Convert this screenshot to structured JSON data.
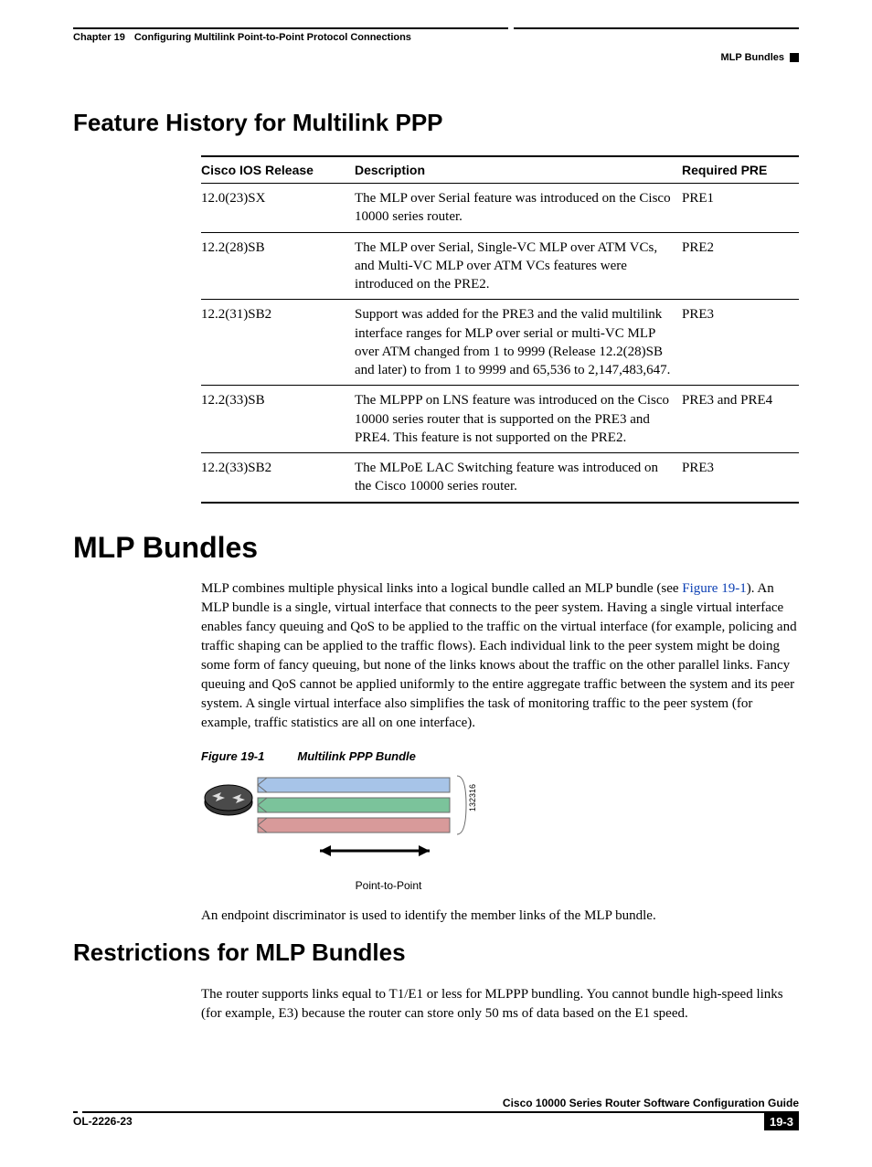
{
  "header": {
    "chapter_label": "Chapter 19",
    "chapter_title": "Configuring Multilink Point-to-Point Protocol Connections",
    "breadcrumb": "MLP Bundles"
  },
  "section1": {
    "title": "Feature History for Multilink PPP",
    "table": {
      "headers": [
        "Cisco IOS Release",
        "Description",
        "Required PRE"
      ],
      "rows": [
        {
          "release": "12.0(23)SX",
          "desc": "The MLP over Serial feature was introduced on the Cisco 10000 series router.",
          "pre": "PRE1"
        },
        {
          "release": "12.2(28)SB",
          "desc": "The MLP over Serial, Single-VC MLP over ATM VCs, and Multi-VC MLP over ATM VCs features were introduced on the PRE2.",
          "pre": "PRE2"
        },
        {
          "release": "12.2(31)SB2",
          "desc": "Support was added for the PRE3 and the valid multilink interface ranges for MLP over serial or multi-VC MLP over ATM changed from 1 to 9999 (Release 12.2(28)SB and later) to from 1 to 9999 and 65,536 to 2,147,483,647.",
          "pre": "PRE3"
        },
        {
          "release": "12.2(33)SB",
          "desc": "The MLPPP on LNS feature was introduced on the Cisco 10000 series router that is supported on the PRE3 and PRE4. This feature is not supported on the PRE2.",
          "pre": "PRE3 and PRE4"
        },
        {
          "release": "12.2(33)SB2",
          "desc": "The MLPoE LAC Switching feature was introduced on the Cisco 10000 series router.",
          "pre": "PRE3"
        }
      ]
    }
  },
  "section2": {
    "title": "MLP Bundles",
    "para_pre": "MLP combines multiple physical links into a logical bundle called an MLP bundle (see ",
    "figref": "Figure 19-1",
    "para_post": "). An MLP bundle is a single, virtual interface that connects to the peer system. Having a single virtual interface enables fancy queuing and QoS to be applied to the traffic on the virtual interface (for example, policing and traffic shaping can be applied to the traffic flows). Each individual link to the peer system might be doing some form of fancy queuing, but none of the links knows about the traffic on the other parallel links. Fancy queuing and QoS cannot be applied uniformly to the entire aggregate traffic between the system and its peer system. A single virtual interface also simplifies the task of monitoring traffic to the peer system (for example, traffic statistics are all on one interface).",
    "figure": {
      "num": "Figure 19-1",
      "title": "Multilink PPP Bundle",
      "label": "Point-to-Point",
      "id": "132316"
    },
    "para2": "An endpoint discriminator is used to identify the member links of the MLP bundle."
  },
  "section3": {
    "title": "Restrictions for MLP Bundles",
    "para": "The router supports links equal to T1/E1 or less for MLPPP bundling. You cannot bundle high-speed links (for example, E3) because the router can store only 50 ms of data based on the E1 speed."
  },
  "footer": {
    "guide": "Cisco 10000 Series Router Software Configuration Guide",
    "doc_id": "OL-2226-23",
    "page": "19-3"
  }
}
